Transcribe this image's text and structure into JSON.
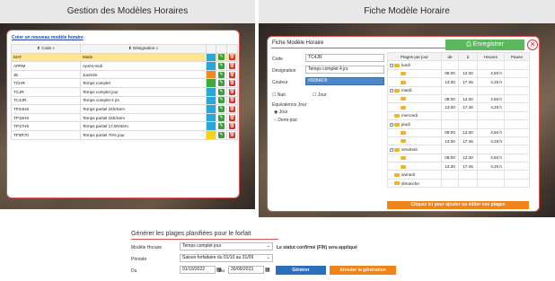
{
  "left_panel": {
    "title": "Gestion des Modèles Horaires",
    "create_link": "Créer un nouveau modèle horaire",
    "columns": {
      "code": "Code",
      "designation": "Désignation"
    },
    "rows": [
      {
        "code": "MAT",
        "designation": "Matin",
        "color": "#2aa6d8",
        "selected": true
      },
      {
        "code": "APRM",
        "designation": "Après-midi",
        "color": "#2aa6d8",
        "selected": false
      },
      {
        "code": "JE",
        "designation": "Journée",
        "color": "#f08a1e",
        "selected": false
      },
      {
        "code": "TCHR",
        "designation": "Temps complet",
        "color": "#3cab3c",
        "selected": false
      },
      {
        "code": "TCJR",
        "designation": "Temps complet jour",
        "color": "#2aa6d8",
        "selected": false
      },
      {
        "code": "TC4JR",
        "designation": "Temps complet 4 jrs",
        "color": "#2aa6d8",
        "selected": false
      },
      {
        "code": "TP24HS",
        "designation": "Temps partiel 24h/Sem",
        "color": "#2aa6d8",
        "selected": false
      },
      {
        "code": "TP15HS",
        "designation": "Temps partiel 15h/Sem",
        "color": "#2aa6d8",
        "selected": false
      },
      {
        "code": "TP17HS",
        "designation": "Temps partiel 17,5h/Sem",
        "color": "#2aa6d8",
        "selected": false
      },
      {
        "code": "TP3R70",
        "designation": "Temps partiel 70% jour",
        "color": "#f6d41b",
        "selected": false
      }
    ]
  },
  "right_panel": {
    "title": "Fiche Modèle Horaire",
    "form_title": "Fiche Modèle Horaire",
    "save_label": "Enregistrer",
    "code_label": "Code",
    "code_value": "TC4JR",
    "designation_label": "Désignation",
    "designation_value": "Temps complet 4 jrs",
    "color_label": "Couleur",
    "color_value": "#00BAD9",
    "nuit_label": "Nuit",
    "jour_label": "Jour",
    "equivalence_label": "Equivalence Jour",
    "eq_jour_label": "Jour",
    "eq_demi_label": "Demi-jour",
    "tree_headers": {
      "plages": "Plages par jour",
      "de": "de",
      "a": "à",
      "heures": "Heures",
      "pause": "Pause"
    },
    "tree_rows": [
      {
        "kind": "day",
        "label": "lundi",
        "de": "",
        "a": "",
        "heures": "",
        "pause": ""
      },
      {
        "kind": "slot",
        "label": "",
        "de": "08:00",
        "a": "12:30",
        "heures": "4,50 h",
        "pause": ""
      },
      {
        "kind": "slot",
        "label": "",
        "de": "13:30",
        "a": "17:45",
        "heures": "4,25 h",
        "pause": ""
      },
      {
        "kind": "day",
        "label": "mardi",
        "de": "",
        "a": "",
        "heures": "",
        "pause": ""
      },
      {
        "kind": "slot",
        "label": "",
        "de": "08:00",
        "a": "12:30",
        "heures": "4,50 h",
        "pause": ""
      },
      {
        "kind": "slot",
        "label": "",
        "de": "13:30",
        "a": "17:45",
        "heures": "4,25 h",
        "pause": ""
      },
      {
        "kind": "empty",
        "label": "mercredi",
        "de": "",
        "a": "",
        "heures": "",
        "pause": ""
      },
      {
        "kind": "day",
        "label": "jeudi",
        "de": "",
        "a": "",
        "heures": "",
        "pause": ""
      },
      {
        "kind": "slot",
        "label": "",
        "de": "08:00",
        "a": "12:30",
        "heures": "4,50 h",
        "pause": ""
      },
      {
        "kind": "slot",
        "label": "",
        "de": "13:30",
        "a": "17:45",
        "heures": "4,25 h",
        "pause": ""
      },
      {
        "kind": "day",
        "label": "vendredi",
        "de": "",
        "a": "",
        "heures": "",
        "pause": ""
      },
      {
        "kind": "slot",
        "label": "",
        "de": "08:00",
        "a": "12:30",
        "heures": "4,50 h",
        "pause": ""
      },
      {
        "kind": "slot",
        "label": "",
        "de": "13:30",
        "a": "17:45",
        "heures": "4,25 h",
        "pause": ""
      },
      {
        "kind": "empty",
        "label": "samedi",
        "de": "",
        "a": "",
        "heures": "",
        "pause": ""
      },
      {
        "kind": "empty",
        "label": "dimanche",
        "de": "",
        "a": "",
        "heures": "",
        "pause": ""
      }
    ],
    "tree_footer": "Cliquez ici pour ajouter ou éditer vos plages"
  },
  "bottom": {
    "title": "Générer les plages planifiées pour le forfait",
    "model_label": "Modèle Horaire",
    "model_value": "Temps complet jour",
    "status_note": "Le statut confirmé (FIN) sera appliqué",
    "period_label": "Période",
    "period_value": "Saison forfaitaire du 01/10 au 31/09",
    "from_label": "Du",
    "from_value": "01/10/2022",
    "to_label": "Au",
    "to_value": "30/09/2023",
    "generate_label": "Générer",
    "cancel_label": "Annuler la génération"
  },
  "colors": {
    "accent_red": "#d9534f",
    "save_green": "#5cb85c",
    "orange": "#f0841a",
    "blue_btn": "#2a6ebf",
    "selected_row": "#ffe58f"
  }
}
